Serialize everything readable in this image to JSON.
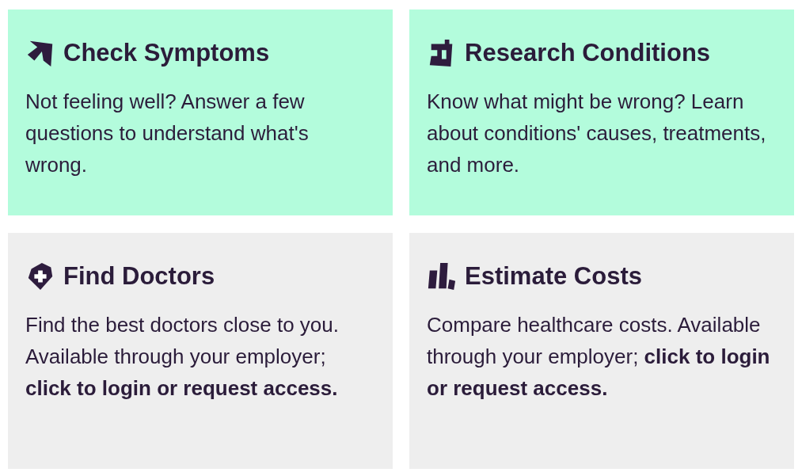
{
  "cards": [
    {
      "kind": "open",
      "title": "Check Symptoms",
      "body": "Not feeling well? Answer a few questions to understand what's wrong."
    },
    {
      "kind": "open",
      "title": "Research Conditions",
      "body": "Know what might be wrong? Learn about conditions' causes, treatments, and more."
    },
    {
      "kind": "restricted",
      "title": "Find Doctors",
      "body": "Find the best doctors close to you. Available through your employer; **click to login or request access.**"
    },
    {
      "kind": "restricted",
      "title": "Estimate Costs",
      "body": "Compare healthcare costs. Available through your employer; **click to login or request access.**"
    }
  ]
}
